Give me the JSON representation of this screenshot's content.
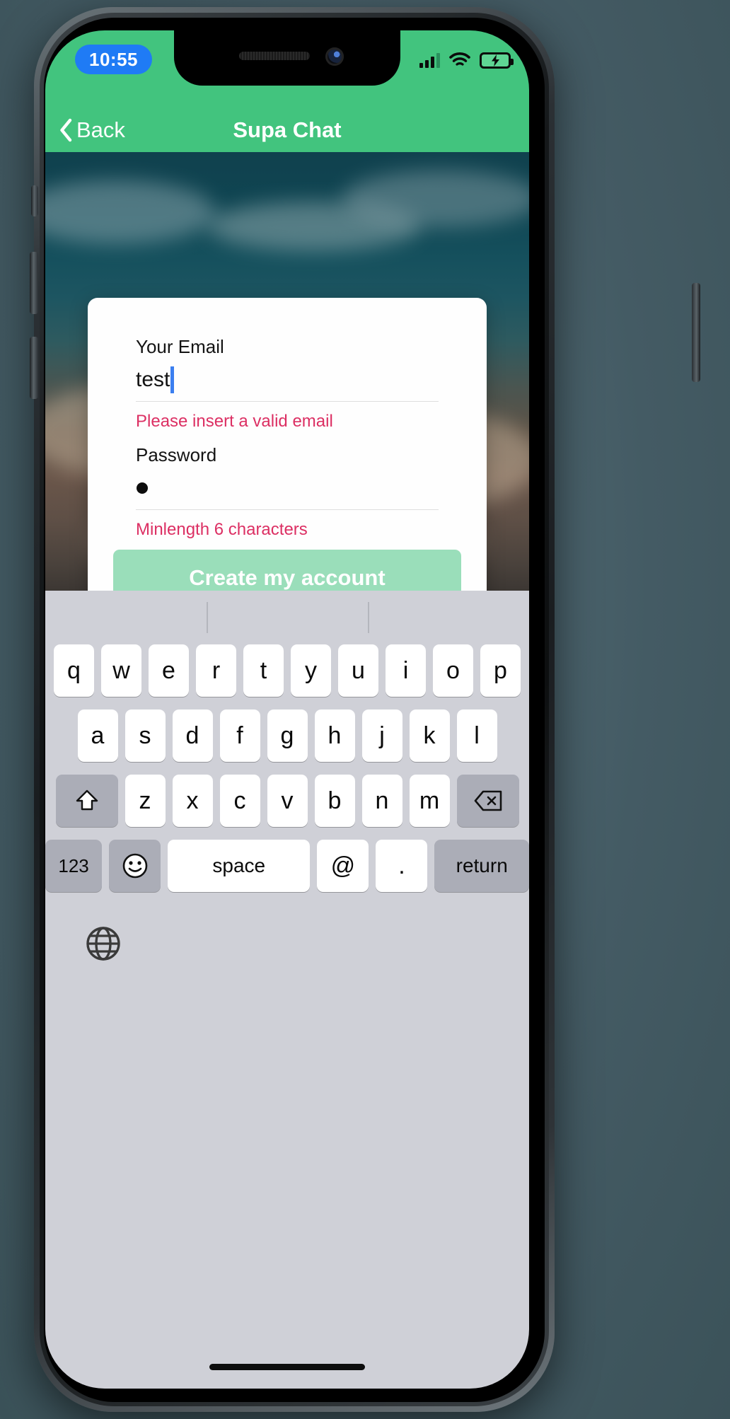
{
  "statusbar": {
    "time": "10:55",
    "icons": [
      "cellular-signal-icon",
      "wifi-icon",
      "battery-charging-icon"
    ]
  },
  "navbar": {
    "back_label": "Back",
    "title": "Supa Chat",
    "back_icon": "chevron-left-icon"
  },
  "form": {
    "email_label": "Your Email",
    "email_value": "test",
    "email_placeholder": "Your Email",
    "email_error": "Please insert a valid email",
    "password_label": "Password",
    "password_value": "•",
    "password_placeholder": "Password",
    "password_error": "Minlength 6 characters",
    "submit_label": "Create my account"
  },
  "colors": {
    "brand_green": "#42c47e",
    "button_green": "#9adeba",
    "error_pink": "#dc2f63",
    "time_pill_blue": "#1f7bf5",
    "caret_blue": "#3b7ff0",
    "keyboard_bg": "#cfd0d7",
    "key_bg": "#ffffff",
    "key_mod_bg": "#abadb7"
  },
  "keyboard": {
    "row1": [
      "q",
      "w",
      "e",
      "r",
      "t",
      "y",
      "u",
      "i",
      "o",
      "p"
    ],
    "row2": [
      "a",
      "s",
      "d",
      "f",
      "g",
      "h",
      "j",
      "k",
      "l"
    ],
    "row3_shift": "shift-icon",
    "row3": [
      "z",
      "x",
      "c",
      "v",
      "b",
      "n",
      "m"
    ],
    "row3_backspace": "backspace-icon",
    "row4": {
      "numbers": "123",
      "emoji": "😀",
      "space": "space",
      "at": "@",
      "period": ".",
      "return": "return"
    },
    "globe": "globe-icon"
  }
}
